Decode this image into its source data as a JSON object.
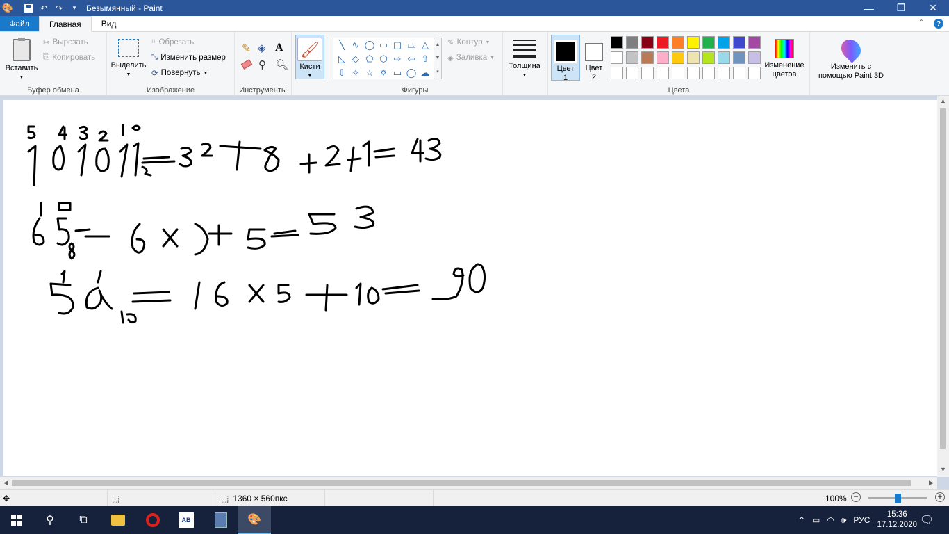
{
  "window": {
    "title": "Безымянный - Paint",
    "minimize": "—",
    "restore": "❐",
    "close": "✕"
  },
  "tabs": [
    {
      "label": "Файл"
    },
    {
      "label": "Главная"
    },
    {
      "label": "Вид"
    }
  ],
  "ribbon": {
    "clipboard": {
      "paste": "Вставить",
      "cut": "Вырезать",
      "copy": "Копировать",
      "group": "Буфер обмена"
    },
    "image": {
      "select": "Выделить",
      "crop": "Обрезать",
      "resize": "Изменить размер",
      "rotate": "Повернуть",
      "group": "Изображение"
    },
    "tools": {
      "group": "Инструменты"
    },
    "brushes": {
      "label": "Кисти"
    },
    "shapes": {
      "outline": "Контур",
      "fill": "Заливка",
      "group": "Фигуры"
    },
    "size": {
      "label": "Толщина"
    },
    "colors": {
      "color1_line1": "Цвет",
      "color1_line2": "1",
      "color2_line1": "Цвет",
      "color2_line2": "2",
      "edit_line1": "Изменение",
      "edit_line2": "цветов",
      "group": "Цвета",
      "palette": [
        "#000000",
        "#7f7f7f",
        "#880015",
        "#ed1c24",
        "#ff7f27",
        "#fff200",
        "#22b14c",
        "#00a2e8",
        "#3f48cc",
        "#a349a4",
        "#ffffff",
        "#c3c3c3",
        "#b97a57",
        "#ffaec9",
        "#ffc90e",
        "#efe4b0",
        "#b5e61d",
        "#99d9ea",
        "#7092be",
        "#c8bfe7",
        "#ffffff",
        "#ffffff",
        "#ffffff",
        "#ffffff",
        "#ffffff",
        "#ffffff",
        "#ffffff",
        "#ffffff",
        "#ffffff",
        "#ffffff"
      ]
    },
    "paint3d": {
      "line1": "Изменить с",
      "line2": "помощью Paint 3D"
    }
  },
  "statusbar": {
    "dimensions": "1360 × 560пкс",
    "zoom": "100%"
  },
  "taskbar": {
    "language": "РУС",
    "time": "15:36",
    "date": "17.12.2020"
  }
}
